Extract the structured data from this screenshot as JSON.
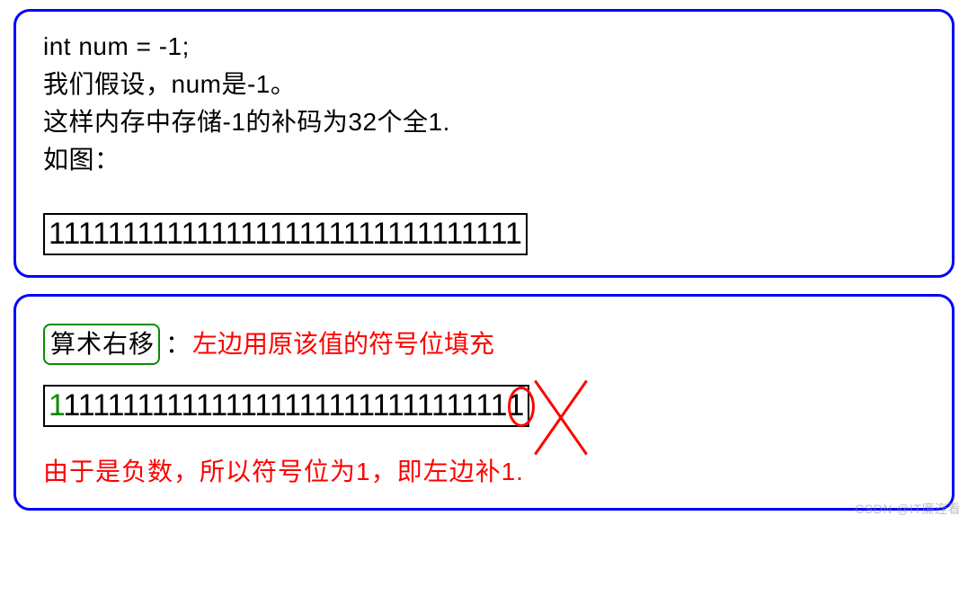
{
  "panel1": {
    "line1": "int num = -1;",
    "line2": "我们假设，num是-1。",
    "line3": "这样内存中存储-1的补码为32个全1.",
    "line4": "如图：",
    "binary": "11111111111111111111111111111111"
  },
  "panel2": {
    "label": "算术右移",
    "colon": "：",
    "desc": "左边用原该值的符号位填充",
    "binary_first": "1",
    "binary_rest": "111111111111111111111111111111",
    "binary_last": "1",
    "explain": "由于是负数，所以符号位为1，即左边补1."
  },
  "watermark": "CSDN @IT廉连看"
}
